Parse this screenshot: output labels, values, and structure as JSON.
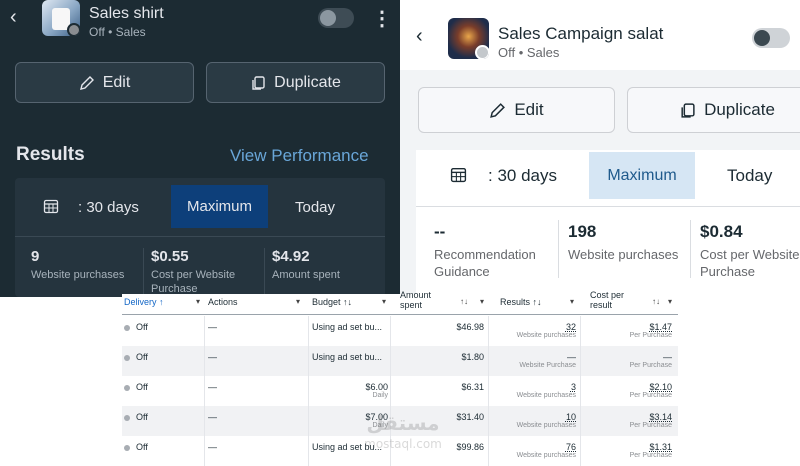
{
  "dark": {
    "campaign_name": "Sales shirt",
    "status": "Off • Sales",
    "edit_label": "Edit",
    "duplicate_label": "Duplicate",
    "results_title": "Results",
    "view_performance": "View Performance",
    "range_label": ": 30 days",
    "maximum_label": "Maximum",
    "today_label": "Today",
    "metrics": [
      {
        "value": "9",
        "label": "Website purchases"
      },
      {
        "value": "$0.55",
        "label": "Cost per Website Purchase"
      },
      {
        "value": "$4.92",
        "label": "Amount spent"
      }
    ]
  },
  "light": {
    "campaign_name": "Sales Campaign salat",
    "status": "Off • Sales",
    "edit_label": "Edit",
    "duplicate_label": "Duplicate",
    "range_label": ": 30 days",
    "maximum_label": "Maximum",
    "today_label": "Today",
    "metrics": [
      {
        "value": "--",
        "label": "Recommendation Guidance"
      },
      {
        "value": "198",
        "label": "Website purchases"
      },
      {
        "value": "$0.84",
        "label": "Cost per Website Purchase"
      }
    ]
  },
  "table": {
    "headers": {
      "delivery": "Delivery ↑",
      "actions": "Actions",
      "budget": "Budget ↑↓",
      "amount_spent": "Amount spent",
      "results": "Results ↑↓",
      "cost_per_result": "Cost per result"
    },
    "rows": [
      {
        "delivery": "Off",
        "actions": "—",
        "budget": "Using ad set bu...",
        "budget_sub": "",
        "spent": "$46.98",
        "results": "32",
        "results_sub": "Website purchases",
        "cost": "$1.47",
        "cost_sub": "Per Purchase"
      },
      {
        "delivery": "Off",
        "actions": "—",
        "budget": "Using ad set bu...",
        "budget_sub": "",
        "spent": "$1.80",
        "results": "—",
        "results_sub": "Website Purchase",
        "cost": "—",
        "cost_sub": "Per Purchase"
      },
      {
        "delivery": "Off",
        "actions": "—",
        "budget": "$6.00",
        "budget_sub": "Daily",
        "spent": "$6.31",
        "results": "3",
        "results_sub": "Website purchases",
        "cost": "$2.10",
        "cost_sub": "Per Purchase"
      },
      {
        "delivery": "Off",
        "actions": "—",
        "budget": "$7.00",
        "budget_sub": "Daily",
        "spent": "$31.40",
        "results": "10",
        "results_sub": "Website purchases",
        "cost": "$3.14",
        "cost_sub": "Per Purchase"
      },
      {
        "delivery": "Off",
        "actions": "—",
        "budget": "Using ad set bu...",
        "budget_sub": "",
        "spent": "$99.86",
        "results": "76",
        "results_sub": "Website purchases",
        "cost": "$1.31",
        "cost_sub": "Per Purchase"
      }
    ]
  },
  "watermark": "مستقل mostaql.com"
}
